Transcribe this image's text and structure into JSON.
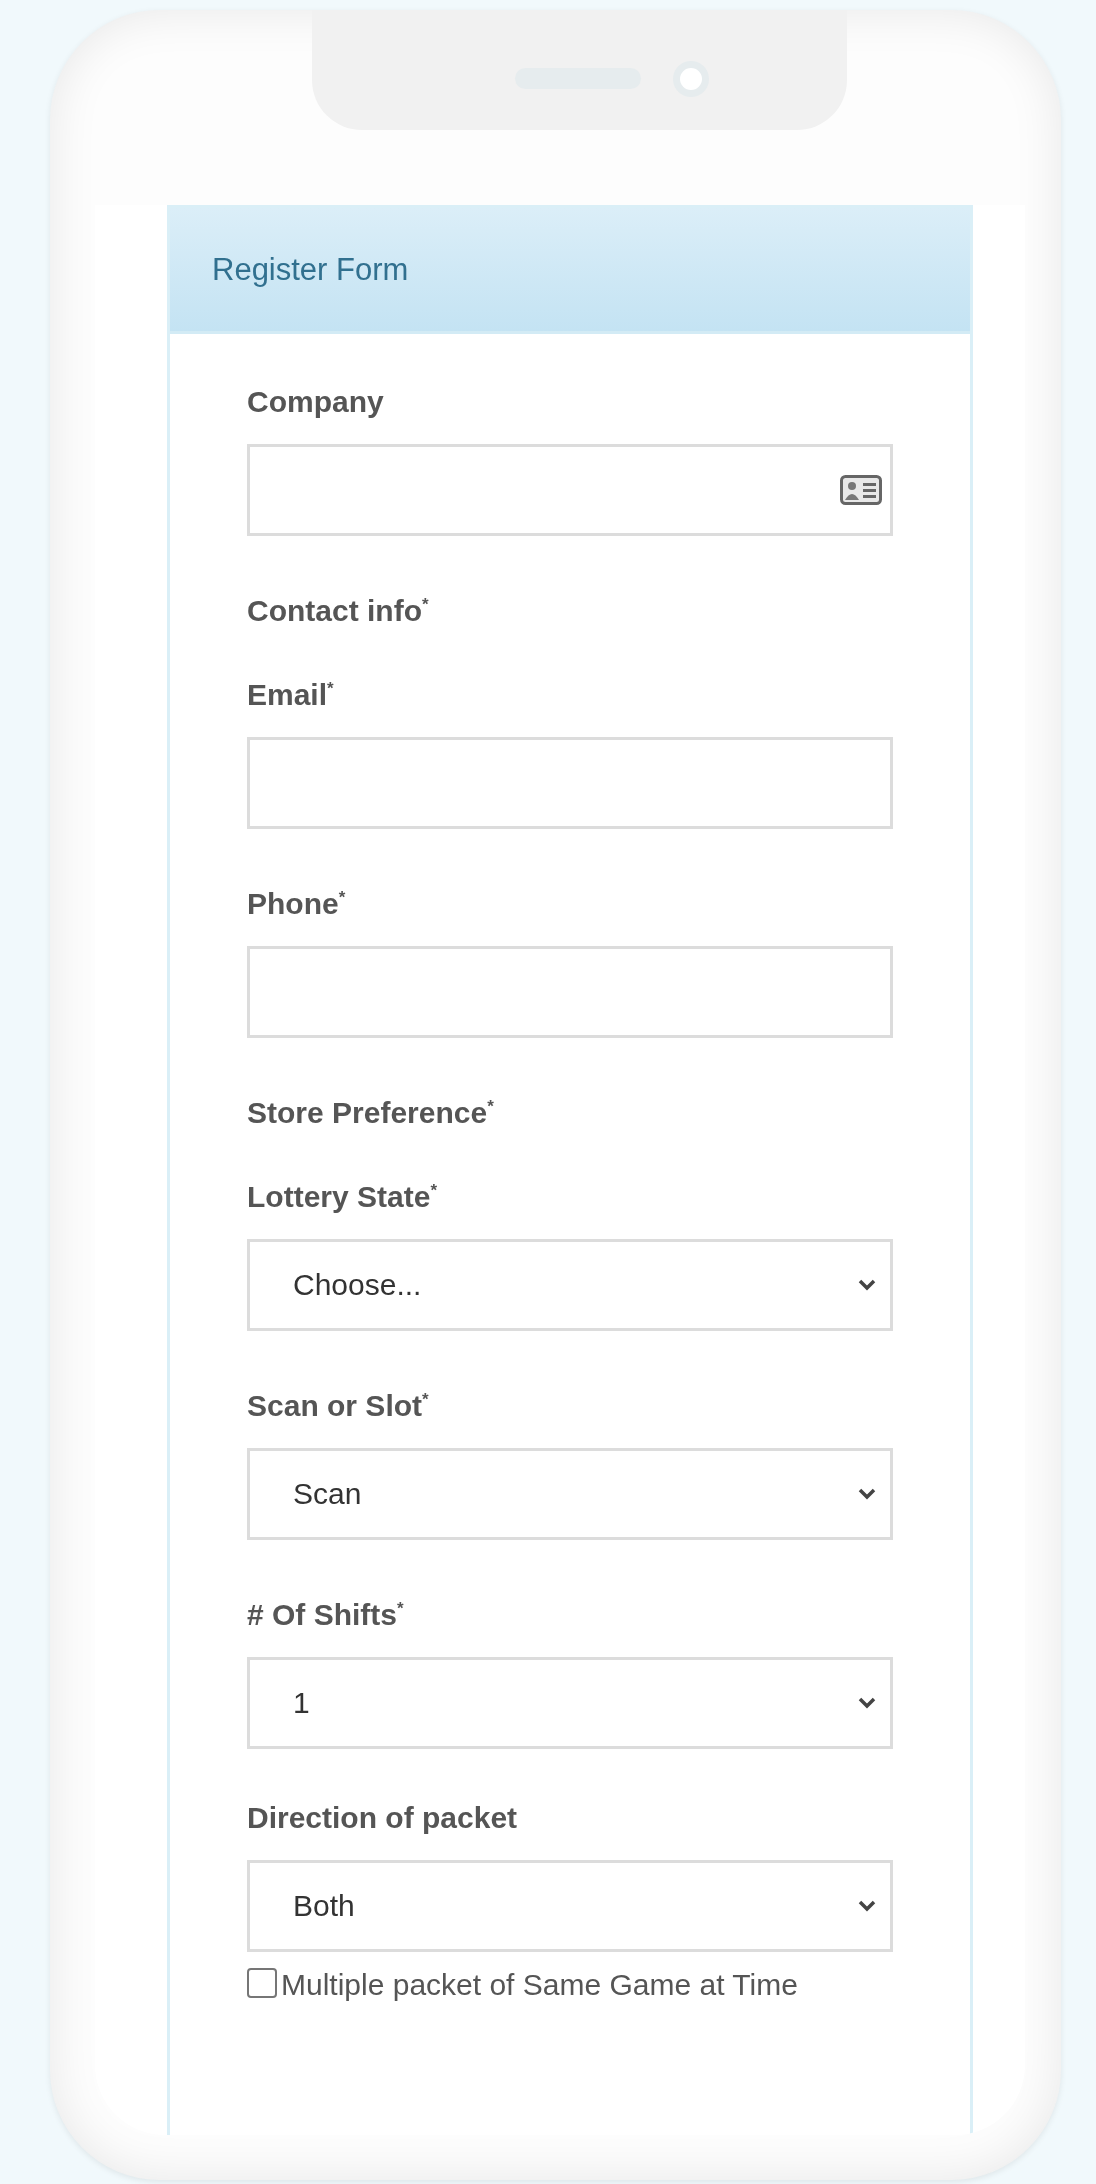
{
  "panel": {
    "title": "Register Form"
  },
  "fields": [
    {
      "kind": "input",
      "label": "Company"
    },
    {
      "kind": "heading",
      "label": "Contact info$^{*}$"
    },
    {
      "kind": "input",
      "label": "Email$^{*}$"
    },
    {
      "kind": "input",
      "label": "Phone$^{*}$"
    },
    {
      "kind": "heading",
      "label": "Store Preference$^{*}$"
    },
    {
      "kind": "select",
      "label": "Lottery State$^{*}$",
      "value": "Choose..."
    },
    {
      "kind": "select",
      "label": "Scan or Slot$^{*}$",
      "value": "Scan"
    },
    {
      "kind": "select",
      "label": "# Of Shifts$^{*}$",
      "value": "1"
    },
    {
      "kind": "select",
      "label": "Direction of packet",
      "value": "Both"
    },
    {
      "kind": "checkbox",
      "label": "Multiple packet of Same Game at Time",
      "checked": false
    }
  ]
}
